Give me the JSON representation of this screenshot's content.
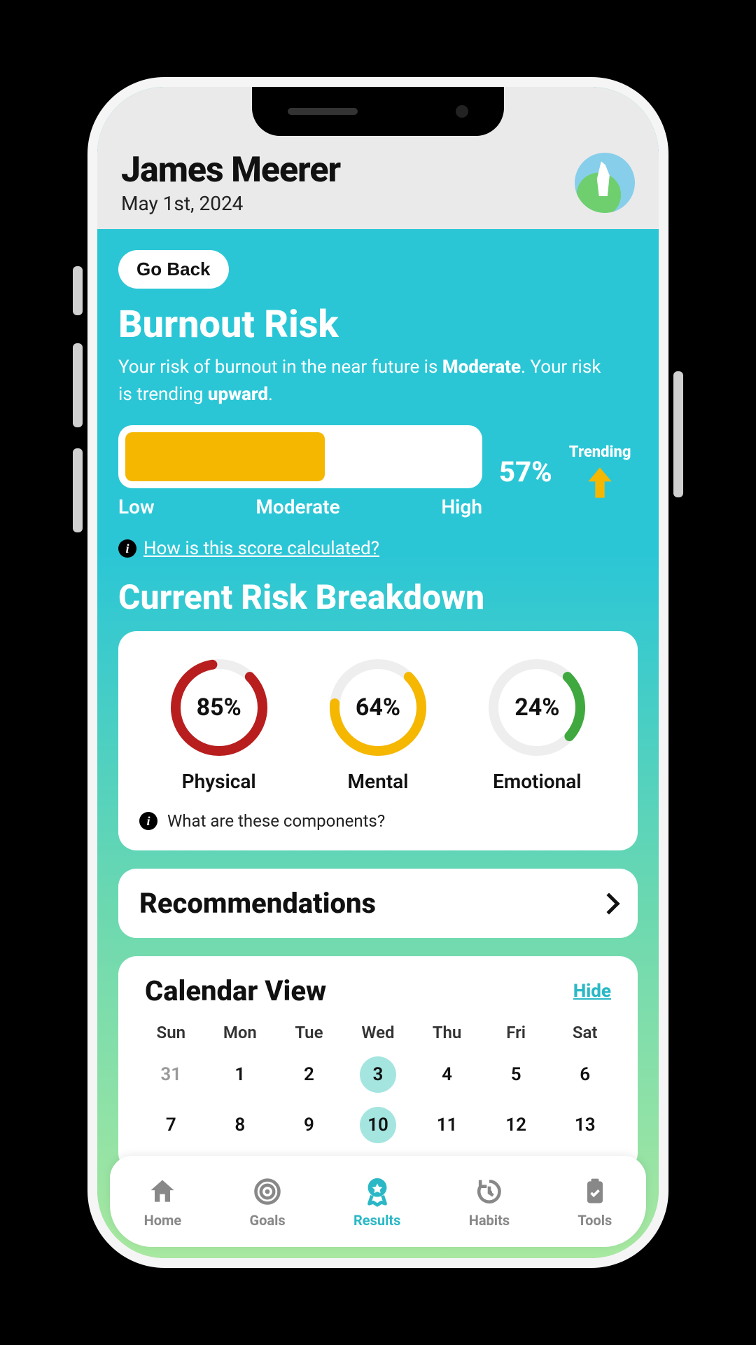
{
  "user": {
    "name": "James Meerer",
    "date": "May 1st, 2024"
  },
  "go_back": "Go Back",
  "burnout": {
    "title": "Burnout Risk",
    "desc_pre": "Your risk of burnout in the near future is ",
    "severity": "Moderate",
    "desc_mid": ". Your risk is trending ",
    "trend": "upward",
    "desc_end": ".",
    "percent_text": "57%",
    "percent_value": 57,
    "labels": {
      "low": "Low",
      "mid": "Moderate",
      "high": "High"
    },
    "trending_label": "Trending",
    "info_link": "How is this score calculated?"
  },
  "breakdown": {
    "title": "Current Risk Breakdown",
    "items": [
      {
        "label": "Physical",
        "value": 85,
        "text": "85%",
        "color": "#B81E1E"
      },
      {
        "label": "Mental",
        "value": 64,
        "text": "64%",
        "color": "#F5B700"
      },
      {
        "label": "Emotional",
        "value": 24,
        "text": "24%",
        "color": "#3FA83F"
      }
    ],
    "info": "What are these components?"
  },
  "recommendations": {
    "title": "Recommendations"
  },
  "calendar": {
    "title": "Calendar View",
    "hide": "Hide",
    "dow": [
      "Sun",
      "Mon",
      "Tue",
      "Wed",
      "Thu",
      "Fri",
      "Sat"
    ],
    "days": [
      {
        "n": "31",
        "dim": true
      },
      {
        "n": "1"
      },
      {
        "n": "2"
      },
      {
        "n": "3",
        "hl": true
      },
      {
        "n": "4"
      },
      {
        "n": "5"
      },
      {
        "n": "6"
      },
      {
        "n": "7"
      },
      {
        "n": "8"
      },
      {
        "n": "9"
      },
      {
        "n": "10",
        "hl": true
      },
      {
        "n": "11"
      },
      {
        "n": "12"
      },
      {
        "n": "13"
      }
    ]
  },
  "tabs": {
    "home": "Home",
    "goals": "Goals",
    "results": "Results",
    "habits": "Habits",
    "tools": "Tools"
  },
  "colors": {
    "accent": "#2BB8C6",
    "bar_fill": "#F5B700"
  }
}
